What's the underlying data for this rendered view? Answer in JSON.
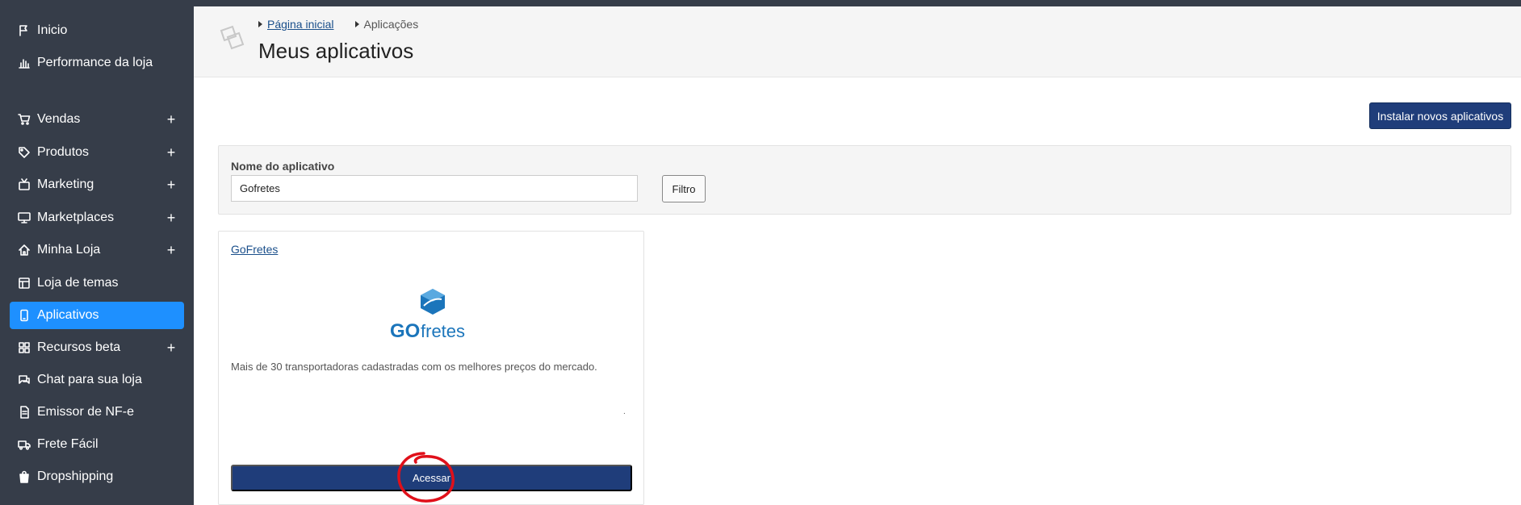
{
  "sidebar": {
    "items": [
      {
        "label": "Inicio",
        "icon": "flag-icon",
        "plus": ""
      },
      {
        "label": "Performance da loja",
        "icon": "bar-chart-icon",
        "plus": ""
      },
      {
        "label": "Vendas",
        "icon": "cart-icon",
        "plus": "+"
      },
      {
        "label": "Produtos",
        "icon": "tag-icon",
        "plus": "+"
      },
      {
        "label": "Marketing",
        "icon": "tv-icon",
        "plus": "+"
      },
      {
        "label": "Marketplaces",
        "icon": "monitor-icon",
        "plus": "+"
      },
      {
        "label": "Minha Loja",
        "icon": "home-icon",
        "plus": "+"
      },
      {
        "label": "Loja de temas",
        "icon": "layout-icon",
        "plus": ""
      },
      {
        "label": "Aplicativos",
        "icon": "phone-icon",
        "plus": ""
      },
      {
        "label": "Recursos beta",
        "icon": "grid-icon",
        "plus": "+"
      },
      {
        "label": "Chat para sua loja",
        "icon": "chat-icon",
        "plus": ""
      },
      {
        "label": "Emissor de NF-e",
        "icon": "document-icon",
        "plus": ""
      },
      {
        "label": "Frete Fácil",
        "icon": "truck-icon",
        "plus": ""
      },
      {
        "label": "Dropshipping",
        "icon": "bag-icon",
        "plus": ""
      }
    ],
    "active_item": "Aplicativos"
  },
  "header": {
    "breadcrumb": [
      "Página inicial",
      "Aplicações"
    ],
    "title": "Meus aplicativos"
  },
  "toolbar": {
    "install_label": "Instalar novos aplicativos"
  },
  "filter": {
    "label": "Nome do aplicativo",
    "value": "Gofretes",
    "button_label": "Filtro"
  },
  "app_card": {
    "name": "GoFretes",
    "logo_text_go": "GO",
    "logo_text_fretes": "fretes",
    "description": "Mais de 30 transportadoras cadastradas com os melhores preços do mercado.",
    "dot": ".",
    "access_label": "Acessar"
  },
  "colors": {
    "sidebar_bg": "#363d49",
    "active": "#1e90ff",
    "primary_button": "#1f3d7a",
    "link": "#1a4f8b",
    "logo_blue": "#1b75bb",
    "annotation": "#e0101a"
  }
}
